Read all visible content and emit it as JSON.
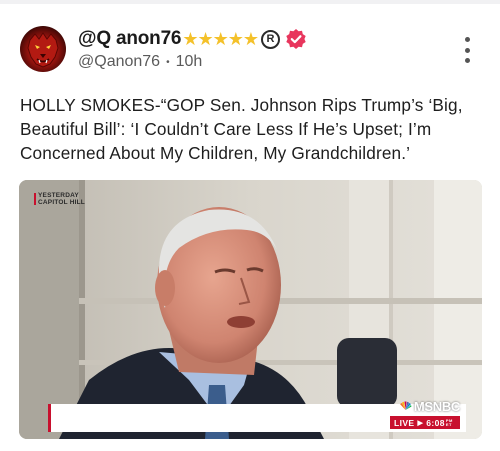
{
  "post": {
    "display_name": "@Q anon76",
    "stars": "★★★★★",
    "registered_mark": "R",
    "handle": "@Qanon76",
    "separator": "•",
    "time_ago": "10h",
    "text": "HOLLY SMOKES-“GOP Sen. Johnson Rips Trump’s ‘Big, Beautiful Bill’: ‘I Couldn’t Care Less If He’s Upset; I’m Concerned About My Children, My Grandchildren.’"
  },
  "icons": {
    "avatar": "red-lion-avatar",
    "verified": "verified-badge-icon",
    "menu": "more-options-icon"
  },
  "video": {
    "location_bug_line1": "YESTERDAY",
    "location_bug_line2": "CAPITOL HILL",
    "network": "MSNBC",
    "live_label": "LIVE",
    "live_time": "6:08",
    "live_time_suffix": "PM ET"
  },
  "colors": {
    "star": "#f4c12a",
    "verified": "#e8365d",
    "live_red": "#c8102e"
  }
}
